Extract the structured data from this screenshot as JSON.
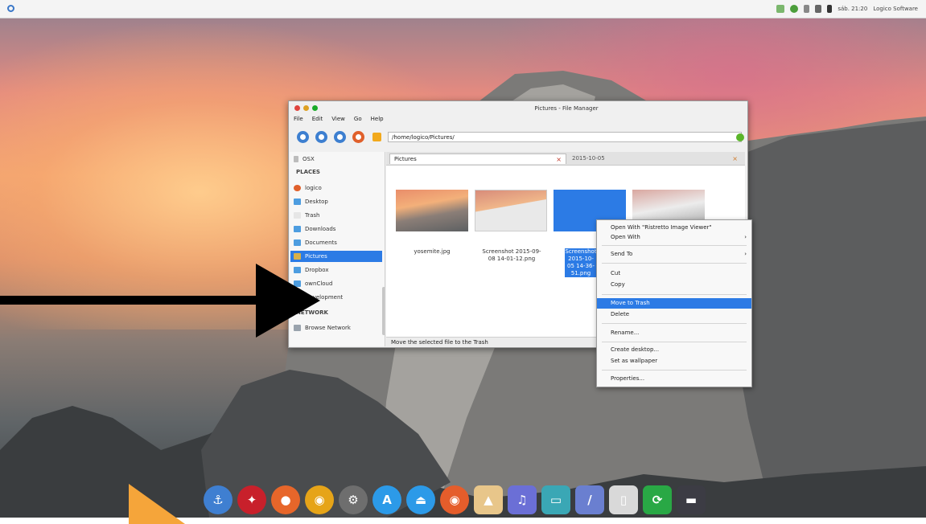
{
  "top_panel": {
    "clock": "sáb. 21:20",
    "user": "Logico Software"
  },
  "file_manager": {
    "title": "Pictures - File Manager",
    "menu": [
      "File",
      "Edit",
      "View",
      "Go",
      "Help"
    ],
    "path": "/home/logico/Pictures/",
    "sidebar": {
      "top_item": "OSX",
      "places_header": "PLACES",
      "places": [
        {
          "label": "logico",
          "icon": "home-icon"
        },
        {
          "label": "Desktop",
          "icon": "folder-icon"
        },
        {
          "label": "Trash",
          "icon": "trash-icon"
        },
        {
          "label": "Downloads",
          "icon": "folder-icon"
        },
        {
          "label": "Documents",
          "icon": "folder-icon"
        },
        {
          "label": "Pictures",
          "icon": "folder-icon",
          "selected": true
        },
        {
          "label": "Dropbox",
          "icon": "folder-icon"
        },
        {
          "label": "ownCloud",
          "icon": "folder-icon"
        },
        {
          "label": "Development",
          "icon": "folder-icon"
        }
      ],
      "network_header": "NETWORK",
      "network": [
        {
          "label": "Browse Network",
          "icon": "network-icon"
        }
      ]
    },
    "tabs": [
      {
        "label": "Pictures",
        "active": true
      },
      {
        "label": "2015-10-05",
        "active": false
      }
    ],
    "files": [
      {
        "name": "yosemite.jpg",
        "selected": false
      },
      {
        "name": "Screenshot 2015-09-08 14-01-12.png",
        "selected": false
      },
      {
        "name": "Screenshot 2015-10-05 14-36-51.png",
        "selected": true
      },
      {
        "name": "",
        "selected": false
      }
    ],
    "status": "Move the selected file to the Trash"
  },
  "context_menu": {
    "items": [
      {
        "label": "Open With \"Ristretto Image Viewer\"",
        "submenu": false
      },
      {
        "label": "Open With",
        "submenu": true
      },
      {
        "sep": true
      },
      {
        "label": "Send To",
        "submenu": true
      },
      {
        "sep": true
      },
      {
        "label": "Cut",
        "submenu": false
      },
      {
        "label": "Copy",
        "submenu": false
      },
      {
        "sep": true
      },
      {
        "label": "Move to Trash",
        "highlighted": true,
        "submenu": false
      },
      {
        "label": "Delete",
        "submenu": false
      },
      {
        "sep": true
      },
      {
        "label": "Rename...",
        "submenu": false
      },
      {
        "sep": true
      },
      {
        "label": "Create desktop...",
        "submenu": false
      },
      {
        "label": "Set as wallpaper",
        "submenu": false
      },
      {
        "sep": true
      },
      {
        "label": "Properties...",
        "submenu": false
      }
    ]
  },
  "dock": {
    "apps": [
      {
        "name": "anchor-icon",
        "color": "#3f7fd1",
        "glyph": "⚓"
      },
      {
        "name": "ruby-icon",
        "color": "#c8202b",
        "glyph": "✦"
      },
      {
        "name": "firefox-icon",
        "color": "#e7662a",
        "glyph": "●"
      },
      {
        "name": "chrome-icon",
        "color": "#e6a418",
        "glyph": "◉"
      },
      {
        "name": "settings-icon",
        "color": "#6e6e6e",
        "glyph": "⚙"
      },
      {
        "name": "app-store-icon",
        "color": "#2c9ae8",
        "glyph": "A"
      },
      {
        "name": "drive-icon",
        "color": "#2c9ae8",
        "glyph": "⏏"
      },
      {
        "name": "chromium-icon",
        "color": "#e55d2b",
        "glyph": "◉"
      },
      {
        "name": "image-viewer-icon",
        "color": "#e8c68a",
        "glyph": "▲"
      },
      {
        "name": "music-icon",
        "color": "#6b6fd6",
        "glyph": "♫"
      },
      {
        "name": "screen-icon",
        "color": "#3aa7b5",
        "glyph": "▭"
      },
      {
        "name": "editor-icon",
        "color": "#6a7fd0",
        "glyph": "/"
      },
      {
        "name": "trash-icon",
        "color": "#d9d9d9",
        "glyph": "▯"
      },
      {
        "name": "sync-icon",
        "color": "#29a845",
        "glyph": "⟳"
      },
      {
        "name": "terminal-icon",
        "color": "#3c3c44",
        "glyph": "▬"
      }
    ]
  }
}
